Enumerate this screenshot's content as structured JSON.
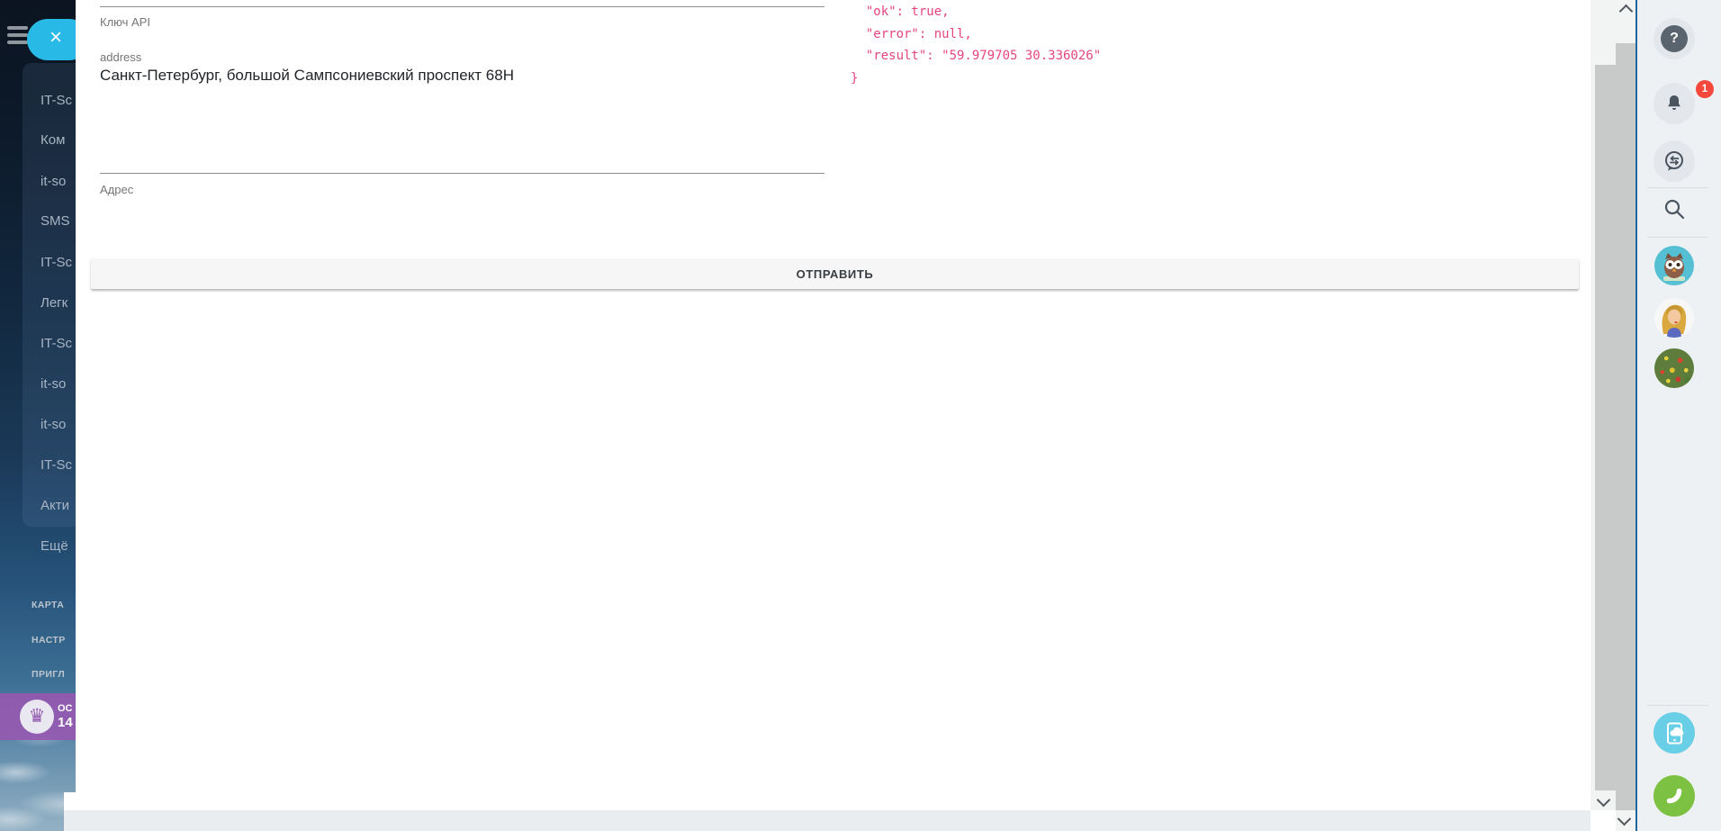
{
  "left_menu": {
    "close_glyph": "×",
    "items": [
      "IT-Sc",
      "Ком",
      "it-so",
      "SMS",
      "IT-Sc",
      "Легк",
      "IT-Sc",
      "it-so",
      "it-so",
      "IT-Sc",
      "Акти",
      "Ещё"
    ],
    "sections": [
      "КАРТА",
      "НАСТР",
      "ПРИГЛ"
    ],
    "trial_banner": {
      "crown_glyph": "♛",
      "line1": "ОС",
      "line2": "14"
    }
  },
  "form": {
    "api_key_helper": "Ключ API",
    "address": {
      "label": "address",
      "value": "Санкт-Петербург, большой Сампсониевский проспект 68Н",
      "helper": "Адрес"
    },
    "submit_label": "ОТПРАВИТЬ"
  },
  "response_json": {
    "lines": [
      "  \"ok\": true,",
      "  \"error\": null,",
      "  \"result\": \"59.979705 30.336026\"",
      "}"
    ]
  },
  "right_toolbar": {
    "help_glyph": "?",
    "notification_badge": "1"
  },
  "colors": {
    "accent_cyan": "#29b9e7",
    "json_pink": "#e5457f",
    "banner_purple": "#9459b0",
    "badge_red": "#f5483c",
    "call_green": "#7cc142",
    "phone_cyan": "#69cfe6"
  }
}
